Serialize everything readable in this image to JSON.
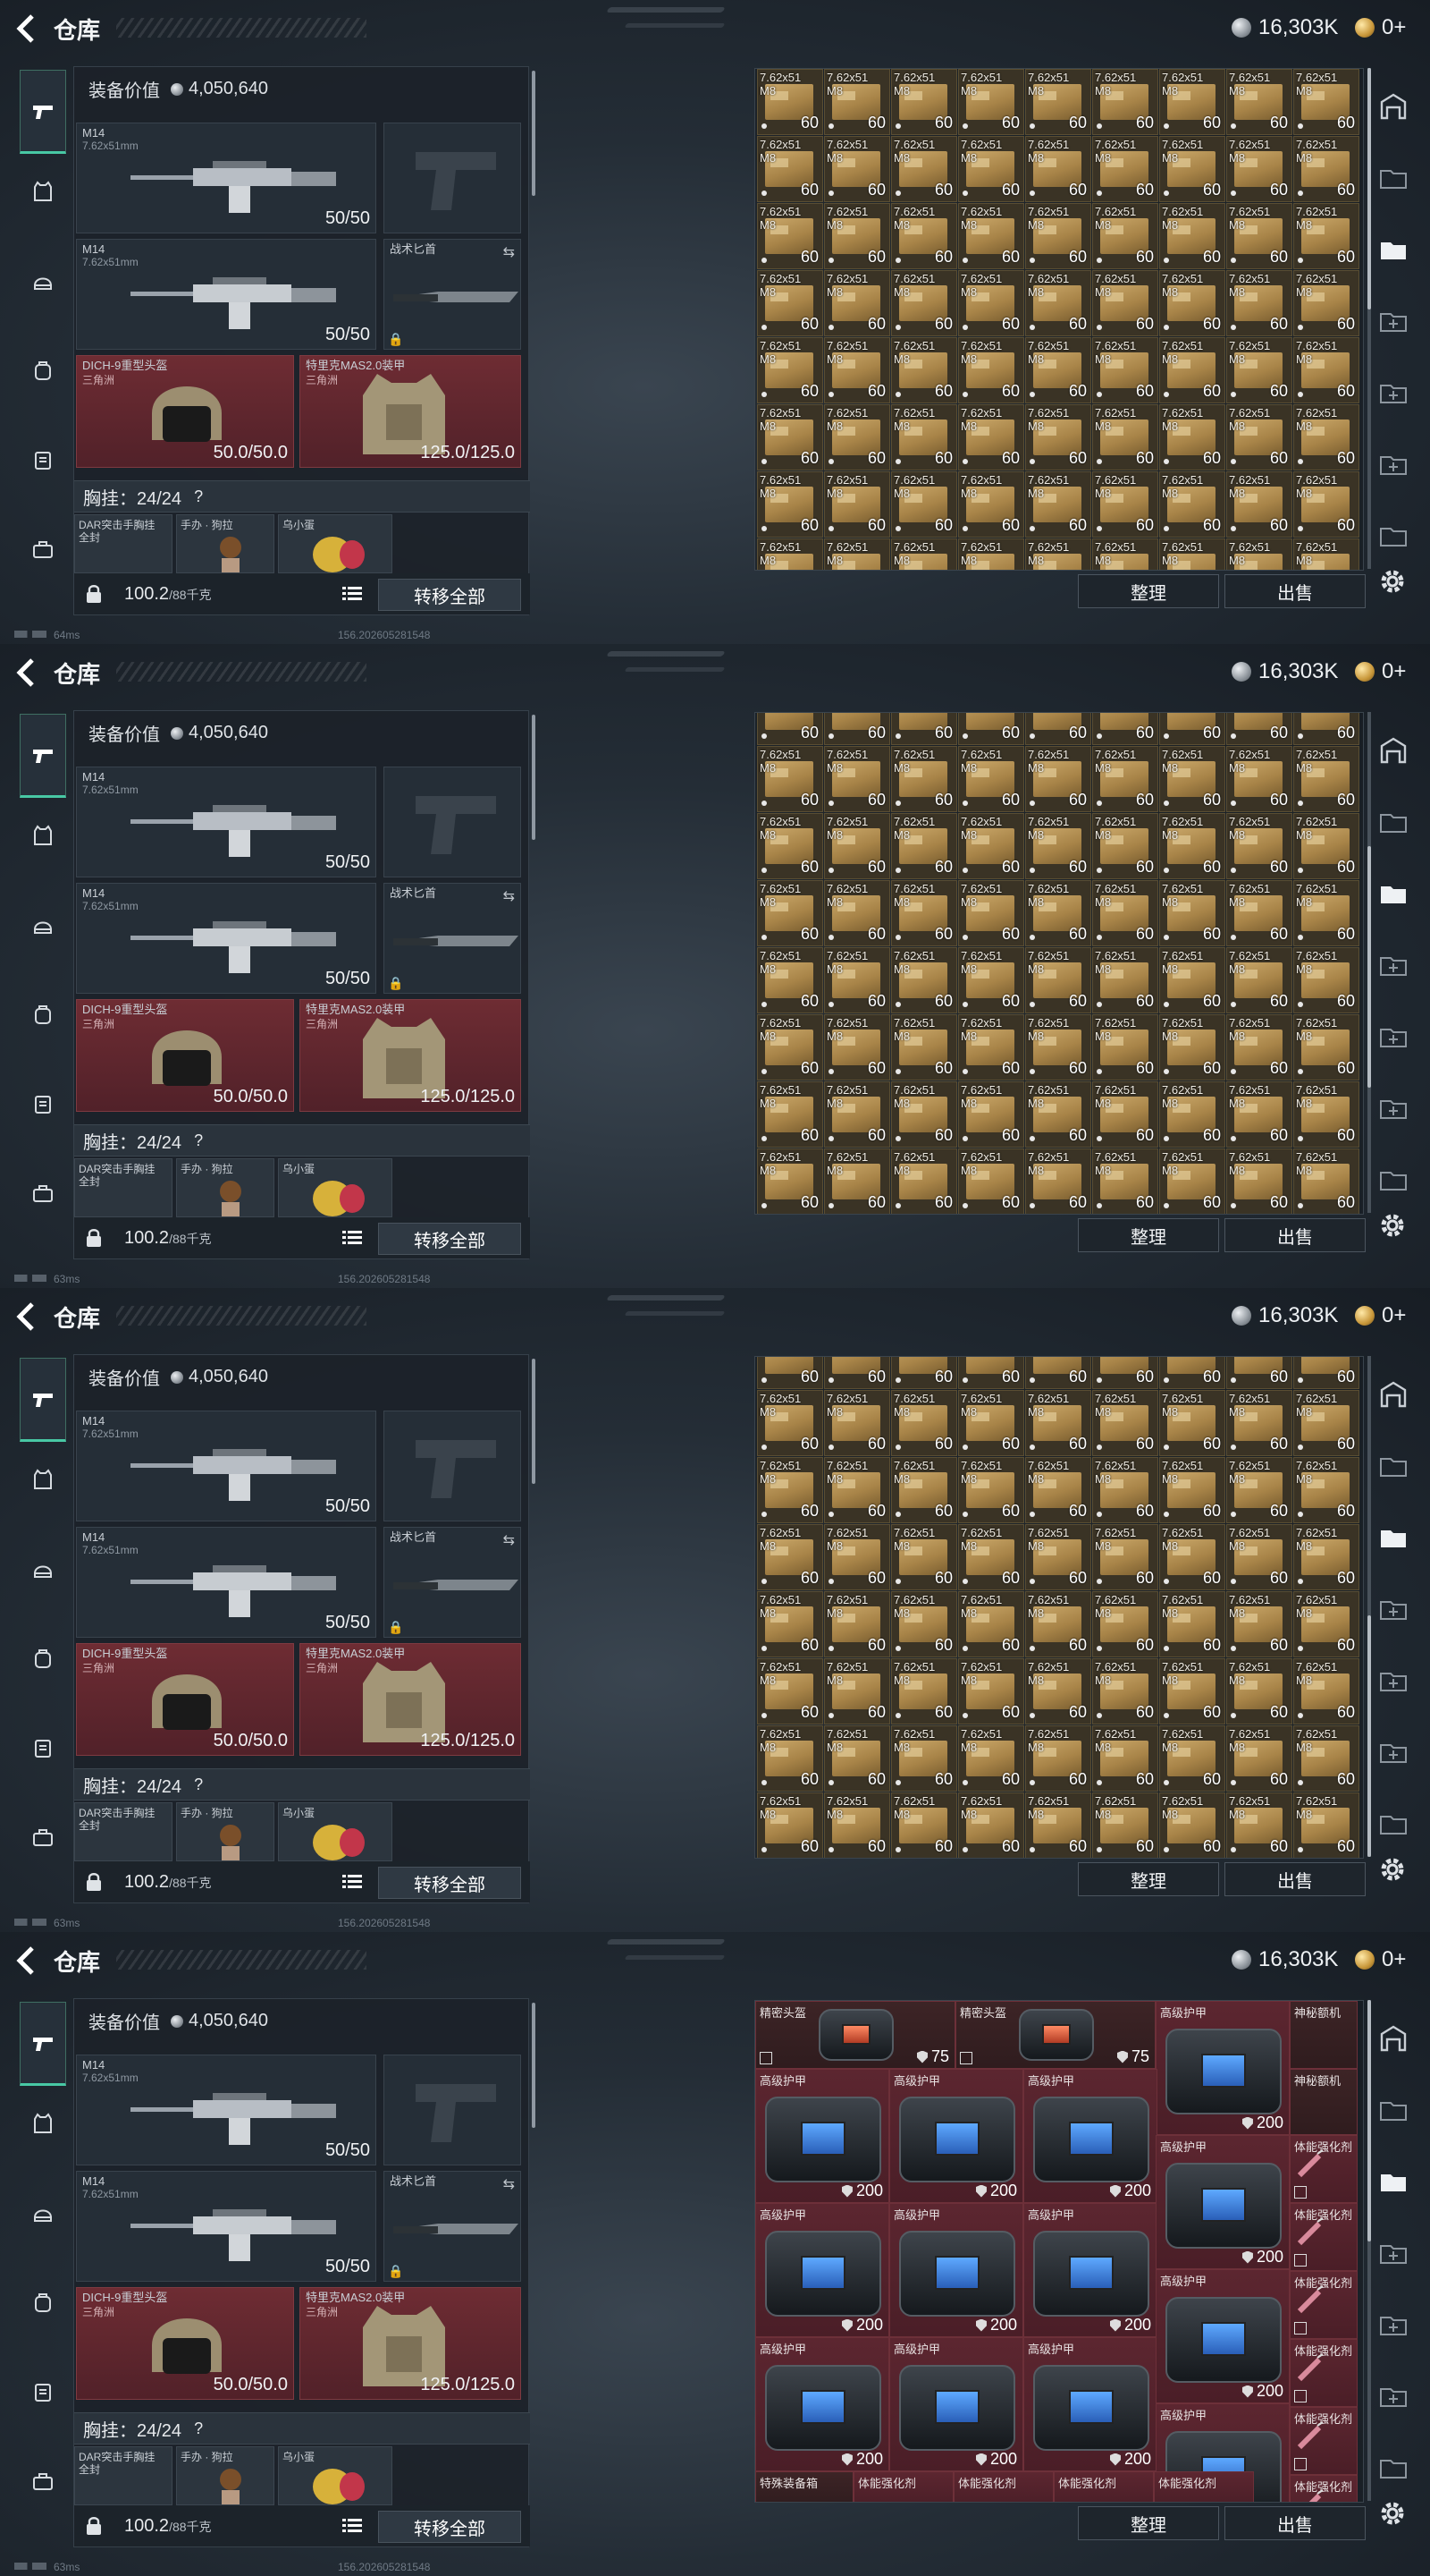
{
  "screen": {
    "title": "仓库",
    "currency_silver": "16,303K",
    "currency_gold": "0+"
  },
  "loadout": {
    "value_label": "装备价值",
    "value": "4,050,640",
    "primary1": {
      "name": "M14",
      "caliber": "7.62x51mm",
      "ammo": "50/50"
    },
    "primary2": {
      "name": "M14",
      "caliber": "7.62x51mm",
      "ammo": "50/50"
    },
    "melee": {
      "name": "战术匕首"
    },
    "helmet": {
      "name": "DICH-9重型头盔",
      "origin": "三角洲",
      "durability": "50.0/50.0"
    },
    "armor": {
      "name": "特里克MAS2.0装甲",
      "origin": "三角洲",
      "durability": "125.0/125.0"
    },
    "vest_label": "胸挂：24/24",
    "vest_help": "?",
    "vest_items": [
      {
        "label": "DAR突击手胸挂",
        "label2": "全封"
      },
      {
        "label": "手办 · 狗拉",
        "label2": ""
      },
      {
        "label": "乌小蛋",
        "label2": ""
      }
    ],
    "weight": "100.2",
    "weight_cap": "/88千克",
    "transfer_all": "转移全部"
  },
  "ammo_item": {
    "name_line1": "7.62x51",
    "name_line2": "M8",
    "count": "60"
  },
  "gear_items": {
    "helmet_label": "精密头盔",
    "helmet_dur": "75",
    "armor_label": "高级护甲",
    "armor_dur": "200",
    "rare_label": "神秘额机",
    "booster_label": "体能强化剂",
    "special_label": "特殊装备箱"
  },
  "buttons": {
    "sort": "整理",
    "sell": "出售"
  },
  "status": {
    "ping1": "64ms",
    "ping2": "63ms",
    "version": "156.202605281548"
  },
  "colors": {
    "accent": "#48c8a4",
    "gear_red": "#5c2630",
    "ammo_tan": "#b08b4e"
  }
}
